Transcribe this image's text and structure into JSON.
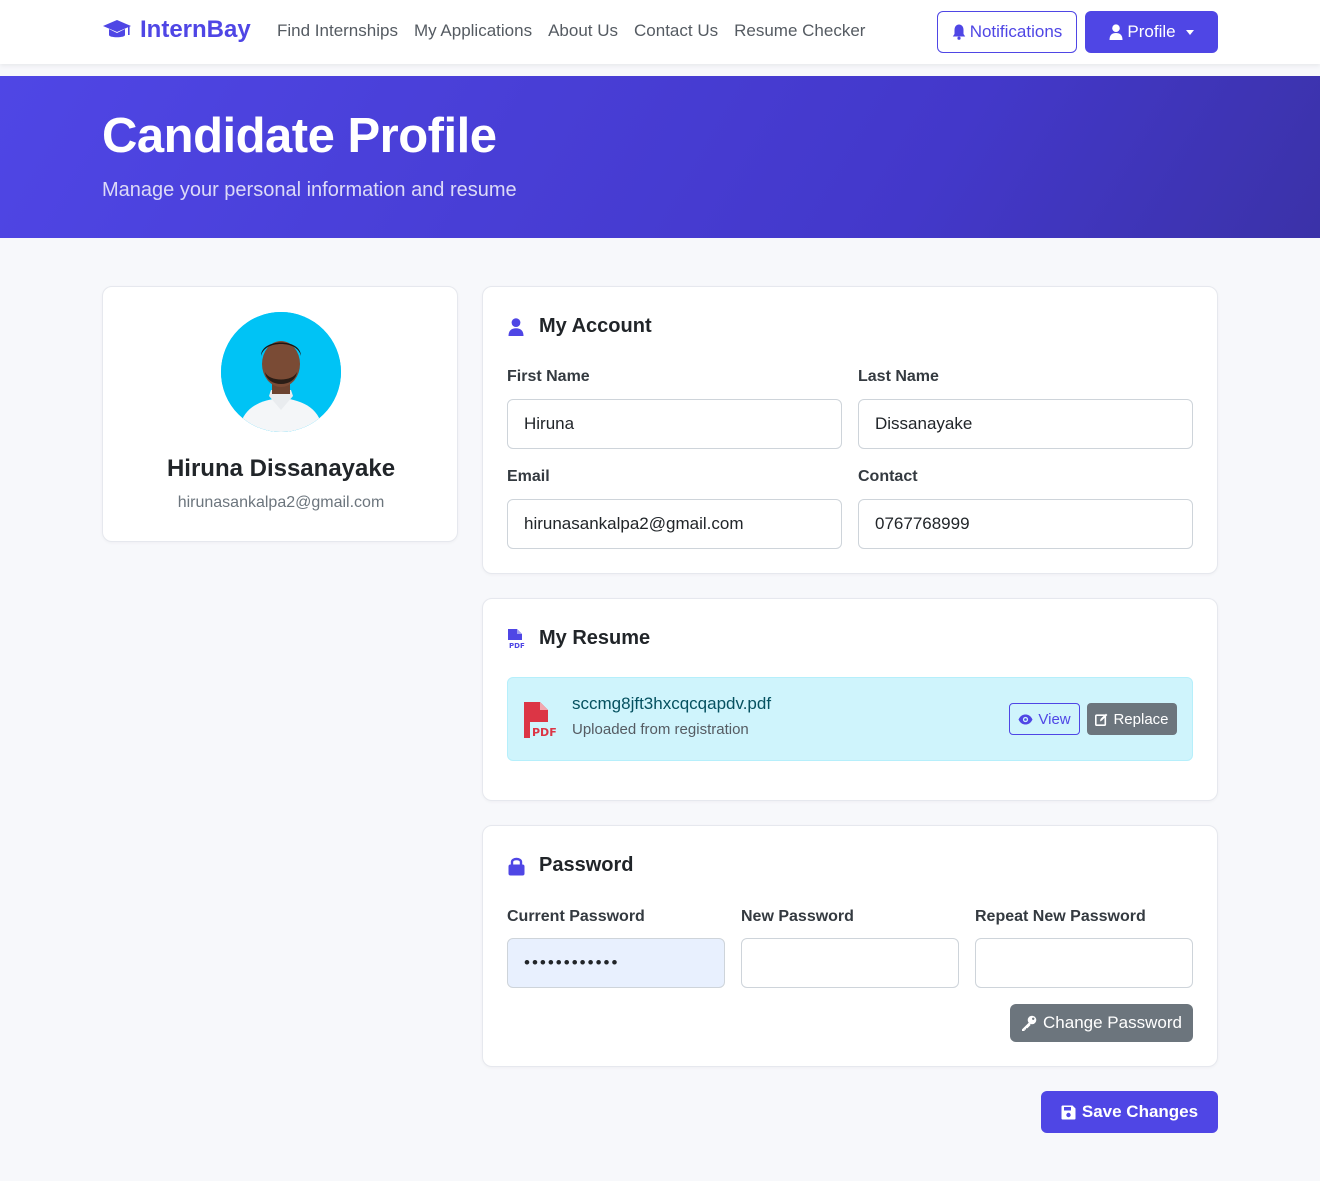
{
  "nav": {
    "brand": "InternBay",
    "links": [
      "Find Internships",
      "My Applications",
      "About Us",
      "Contact Us",
      "Resume Checker"
    ],
    "notifications_label": "Notifications",
    "profile_label": "Profile"
  },
  "hero": {
    "title": "Candidate Profile",
    "subtitle": "Manage your personal information and resume"
  },
  "profile": {
    "name": "Hiruna Dissanayake",
    "email": "hirunasankalpa2@gmail.com"
  },
  "account": {
    "title": "My Account",
    "first_name_label": "First Name",
    "first_name_value": "Hiruna",
    "last_name_label": "Last Name",
    "last_name_value": "Dissanayake",
    "email_label": "Email",
    "email_value": "hirunasankalpa2@gmail.com",
    "contact_label": "Contact",
    "contact_value": "0767768999"
  },
  "resume": {
    "title": "My Resume",
    "file_name": "sccmg8jft3hxcqcqapdv.pdf",
    "file_note": "Uploaded from registration",
    "view_label": "View",
    "replace_label": "Replace"
  },
  "password": {
    "title": "Password",
    "current_label": "Current Password",
    "current_value": "••••••••••••",
    "new_label": "New Password",
    "repeat_label": "Repeat New Password",
    "change_label": "Change Password"
  },
  "save_label": "Save Changes",
  "colors": {
    "primary": "#4f46e5",
    "secondary": "#6c757d",
    "info_bg": "#cff4fc",
    "pdf_red": "#dc3545"
  }
}
